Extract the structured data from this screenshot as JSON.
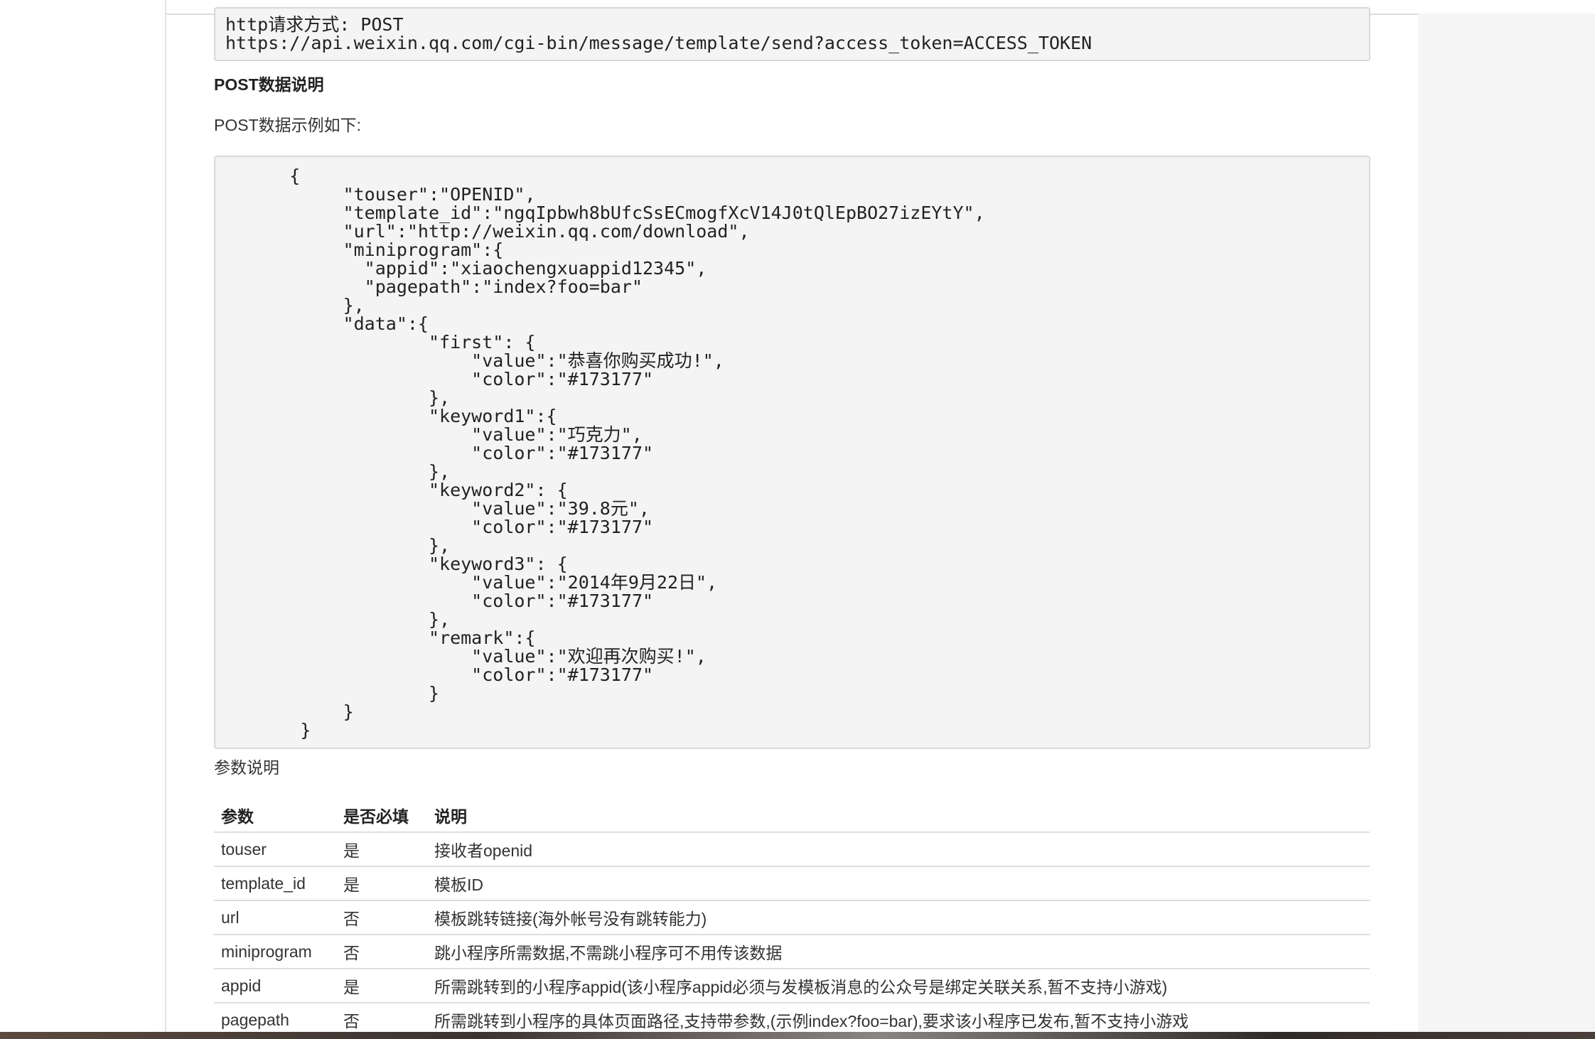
{
  "request": {
    "method_line": "http请求方式: POST",
    "url_line": "https://api.weixin.qq.com/cgi-bin/message/template/send?access_token=ACCESS_TOKEN"
  },
  "post_section": {
    "heading": "POST数据说明",
    "intro": "POST数据示例如下:",
    "example": "      {\n           \"touser\":\"OPENID\",\n           \"template_id\":\"ngqIpbwh8bUfcSsECmogfXcV14J0tQlEpBO27izEYtY\",\n           \"url\":\"http://weixin.qq.com/download\",\n           \"miniprogram\":{\n             \"appid\":\"xiaochengxuappid12345\",\n             \"pagepath\":\"index?foo=bar\"\n           },\n           \"data\":{\n                   \"first\": {\n                       \"value\":\"恭喜你购买成功!\",\n                       \"color\":\"#173177\"\n                   },\n                   \"keyword1\":{\n                       \"value\":\"巧克力\",\n                       \"color\":\"#173177\"\n                   },\n                   \"keyword2\": {\n                       \"value\":\"39.8元\",\n                       \"color\":\"#173177\"\n                   },\n                   \"keyword3\": {\n                       \"value\":\"2014年9月22日\",\n                       \"color\":\"#173177\"\n                   },\n                   \"remark\":{\n                       \"value\":\"欢迎再次购买!\",\n                       \"color\":\"#173177\"\n                   }\n           }\n       }"
  },
  "params_section": {
    "title": "参数说明",
    "headers": [
      "参数",
      "是否必填",
      "说明"
    ],
    "rows": [
      [
        "touser",
        "是",
        "接收者openid"
      ],
      [
        "template_id",
        "是",
        "模板ID"
      ],
      [
        "url",
        "否",
        "模板跳转链接(海外帐号没有跳转能力)"
      ],
      [
        "miniprogram",
        "否",
        "跳小程序所需数据,不需跳小程序可不用传该数据"
      ],
      [
        "appid",
        "是",
        "所需跳转到的小程序appid(该小程序appid必须与发模板消息的公众号是绑定关联关系,暂不支持小游戏)"
      ],
      [
        "pagepath",
        "否",
        "所需跳转到小程序的具体页面路径,支持带参数,(示例index?foo=bar),要求该小程序已发布,暂不支持小游戏"
      ]
    ]
  },
  "colors": {
    "code_background": "#f4f4f4",
    "code_border": "#d9d9d9",
    "table_border": "#dddddd",
    "right_gutter": "#f5f5f5"
  }
}
